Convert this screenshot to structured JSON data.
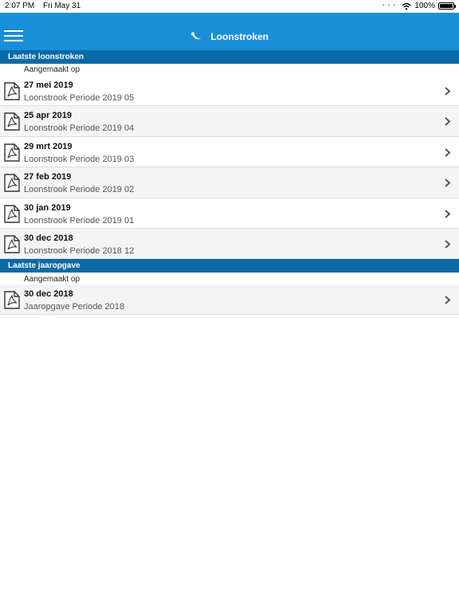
{
  "status_bar": {
    "time": "2:07 PM",
    "date": "Fri May 31",
    "battery_text": "100%",
    "battery_level": 1.0
  },
  "nav": {
    "title": "Loonstroken"
  },
  "sections": [
    {
      "header": "Laatste loonstroken",
      "caption": "Aangemaakt op",
      "items": [
        {
          "date": "27 mei 2019",
          "description": "Loonstrook Periode 2019 05"
        },
        {
          "date": "25 apr 2019",
          "description": "Loonstrook Periode 2019 04"
        },
        {
          "date": "29 mrt 2019",
          "description": "Loonstrook Periode 2019 03"
        },
        {
          "date": "27 feb 2019",
          "description": "Loonstrook Periode 2019 02"
        },
        {
          "date": "30 jan 2019",
          "description": "Loonstrook Periode 2019 01"
        },
        {
          "date": "30 dec 2018",
          "description": "Loonstrook Periode 2018 12"
        }
      ]
    },
    {
      "header": "Laatste jaaropgave",
      "caption": "Aangemaakt op",
      "items": [
        {
          "date": "30 dec 2018",
          "description": "Jaaropgave Periode 2018"
        }
      ]
    }
  ],
  "icons": {
    "menu": "hamburger-menu-icon",
    "logo": "brand-logo-icon",
    "file": "pdf-file-icon",
    "chevron": "chevron-right-icon",
    "wifi": "wifi-icon",
    "battery": "battery-icon"
  },
  "colors": {
    "nav_bg": "#1a8fd9",
    "section_header_bg": "#0a6aa8",
    "row_alt_bg": "#f4f4f4"
  }
}
